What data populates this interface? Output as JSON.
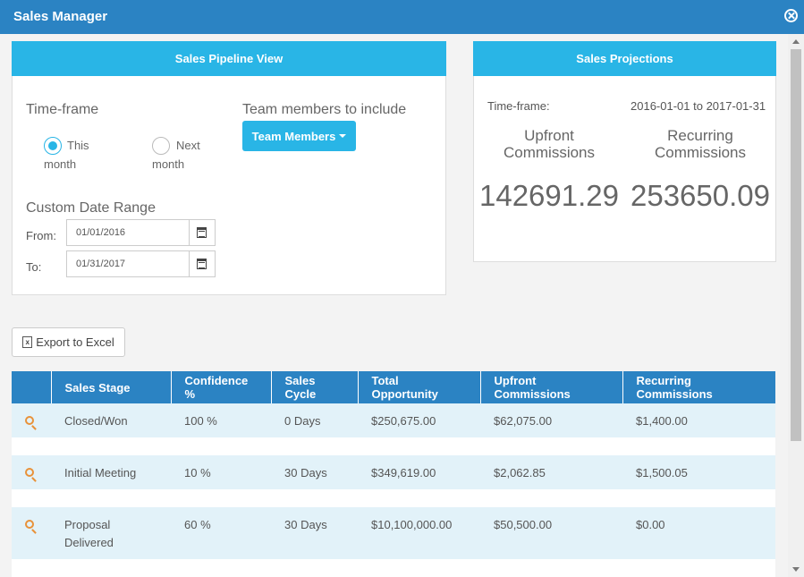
{
  "window": {
    "title": "Sales Manager"
  },
  "pipeline": {
    "heading": "Sales Pipeline View",
    "timeframe_label": "Time-frame",
    "radio_this": [
      "This",
      "month"
    ],
    "radio_next": [
      "Next",
      "month"
    ],
    "team_label": "Team members to include",
    "team_button": "Team Members",
    "custom_label": "Custom Date Range",
    "from_label": "From:",
    "from_value": "01/01/2016",
    "to_label": "To:",
    "to_value": "01/31/2017"
  },
  "projections": {
    "heading": "Sales Projections",
    "timeframe_label": "Time-frame:",
    "timeframe_value": "2016-01-01 to 2017-01-31",
    "upfront_label": [
      "Upfront",
      "Commissions"
    ],
    "recurring_label": [
      "Recurring",
      "Commissions"
    ],
    "upfront_value": "142691.29",
    "recurring_value": "253650.09"
  },
  "export_button": "Export to Excel",
  "table": {
    "headers": [
      "Sales Stage",
      "Confidence %",
      "Sales Cycle",
      "Total Opportunity",
      "Upfront Commissions",
      "Recurring Commissions"
    ],
    "rows": [
      [
        "Closed/Won",
        "100 %",
        "0 Days",
        "$250,675.00",
        "$62,075.00",
        "$1,400.00"
      ],
      [
        "Initial Meeting",
        "10 %",
        "30 Days",
        "$349,619.00",
        "$2,062.85",
        "$1,500.05"
      ],
      [
        "Proposal Delivered",
        "60 %",
        "30 Days",
        "$10,100,000.00",
        "$50,500.00",
        "$0.00"
      ]
    ]
  }
}
